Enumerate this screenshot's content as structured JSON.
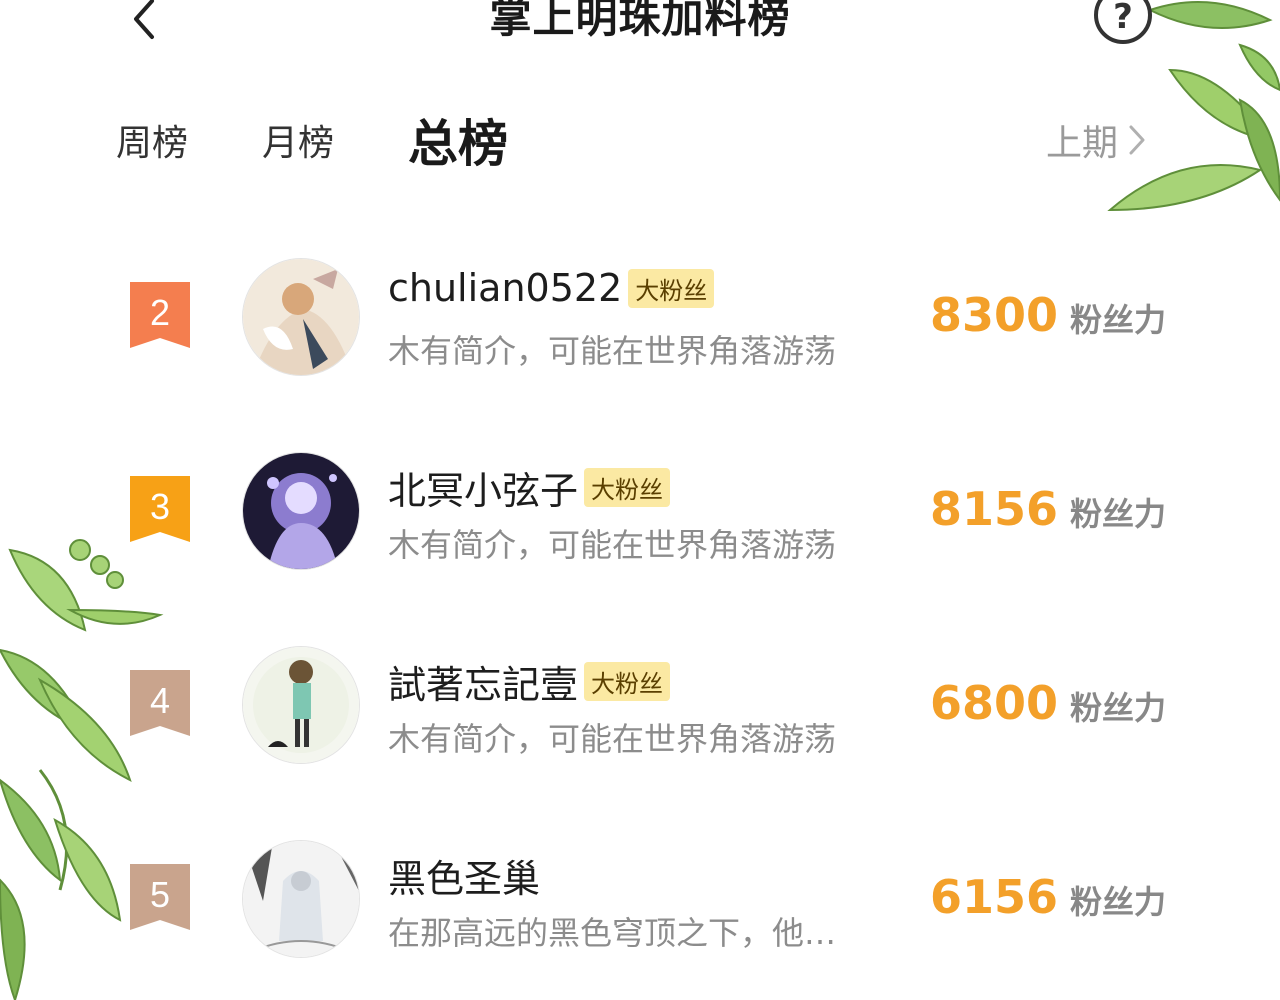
{
  "header": {
    "title": "掌上明珠加料榜",
    "back_icon": "chevron-left-icon",
    "help_icon": "question-circle-icon"
  },
  "tabs": {
    "items": [
      {
        "label": "周榜",
        "active": false
      },
      {
        "label": "月榜",
        "active": false
      },
      {
        "label": "总榜",
        "active": true
      }
    ],
    "prev_label": "上期"
  },
  "colors": {
    "score": "#f3a02a",
    "rank2": "#f47e4f",
    "rank3": "#f7a116",
    "rank_other": "#c9a48d",
    "badge_bg": "#fbe9a3"
  },
  "ranking": [
    {
      "rank": "2",
      "name": "chulian0522",
      "badge": "大粉丝",
      "bio": "木有简介，可能在世界角落游荡",
      "score": "8300",
      "unit": "粉丝力"
    },
    {
      "rank": "3",
      "name": "北冥小弦子",
      "badge": "大粉丝",
      "bio": "木有简介，可能在世界角落游荡",
      "score": "8156",
      "unit": "粉丝力"
    },
    {
      "rank": "4",
      "name": "試著忘記壹",
      "badge": "大粉丝",
      "bio": "木有简介，可能在世界角落游荡",
      "score": "6800",
      "unit": "粉丝力"
    },
    {
      "rank": "5",
      "name": "黑色圣巢",
      "badge": "",
      "bio": "在那高远的黑色穹顶之下，他…",
      "score": "6156",
      "unit": "粉丝力"
    }
  ]
}
